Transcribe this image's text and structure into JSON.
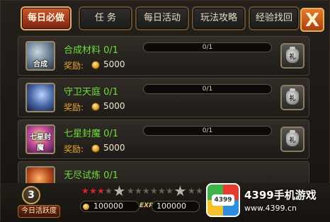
{
  "tabs": [
    {
      "label": "每日必做",
      "active": true
    },
    {
      "label": "任  务",
      "active": false
    },
    {
      "label": "每日活动",
      "active": false
    },
    {
      "label": "玩法攻略",
      "active": false
    },
    {
      "label": "经验找回",
      "active": false
    }
  ],
  "close_label": "X",
  "reward_label": "奖励:",
  "tasks": [
    {
      "name": "合成材料 0/1",
      "icon_text": "合成",
      "progress": "0/1",
      "progress_value": 0,
      "reward": "5000",
      "gift": "礼"
    },
    {
      "name": "守卫天庭 0/1",
      "icon_text": "",
      "progress": "0/1",
      "progress_value": 0,
      "reward": "5000",
      "gift": "礼"
    },
    {
      "name": "七星封魔 0/1",
      "icon_text": "七星封魔",
      "progress": "0/1",
      "progress_value": 0,
      "reward": "5000",
      "gift": "礼"
    },
    {
      "name": "无尽试炼 0/1",
      "icon_text": "",
      "progress": "",
      "progress_value": 0,
      "reward": "",
      "gift": ""
    }
  ],
  "activity": {
    "value": "3",
    "label": "今日活跃度"
  },
  "bottom": {
    "coin_value": "100000",
    "exp_label": "EXP",
    "exp_value": "100000"
  },
  "watermark": {
    "logo_text": "4399",
    "title": "4399手机游戏",
    "url": "www.4399.cn"
  },
  "colors": {
    "task_name": "#6fdc3a",
    "reward_label": "#e7a533",
    "active_tab": "#cc5a32",
    "star_on": "#d7262b"
  }
}
